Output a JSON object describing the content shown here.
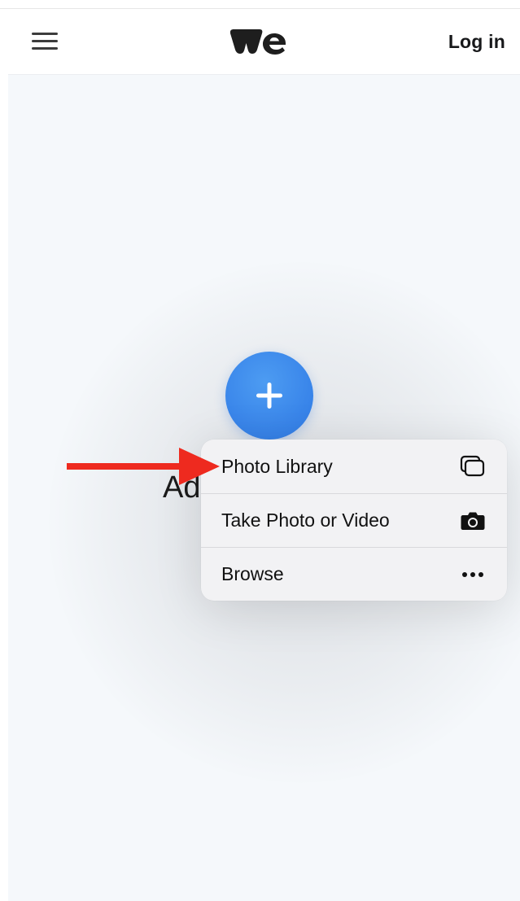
{
  "header": {
    "logo_text": "we",
    "login_label": "Log in"
  },
  "main": {
    "add_label": "Add files"
  },
  "sheet": {
    "items": [
      {
        "label": "Photo Library",
        "icon": "photo-library-icon"
      },
      {
        "label": "Take Photo or Video",
        "icon": "camera-icon"
      },
      {
        "label": "Browse",
        "icon": "ellipsis-icon"
      }
    ]
  },
  "colors": {
    "accent_blue": "#3a86ea",
    "arrow_red": "#ee2a1f",
    "background": "#f5f8fb",
    "sheet_bg": "#f2f2f4"
  }
}
